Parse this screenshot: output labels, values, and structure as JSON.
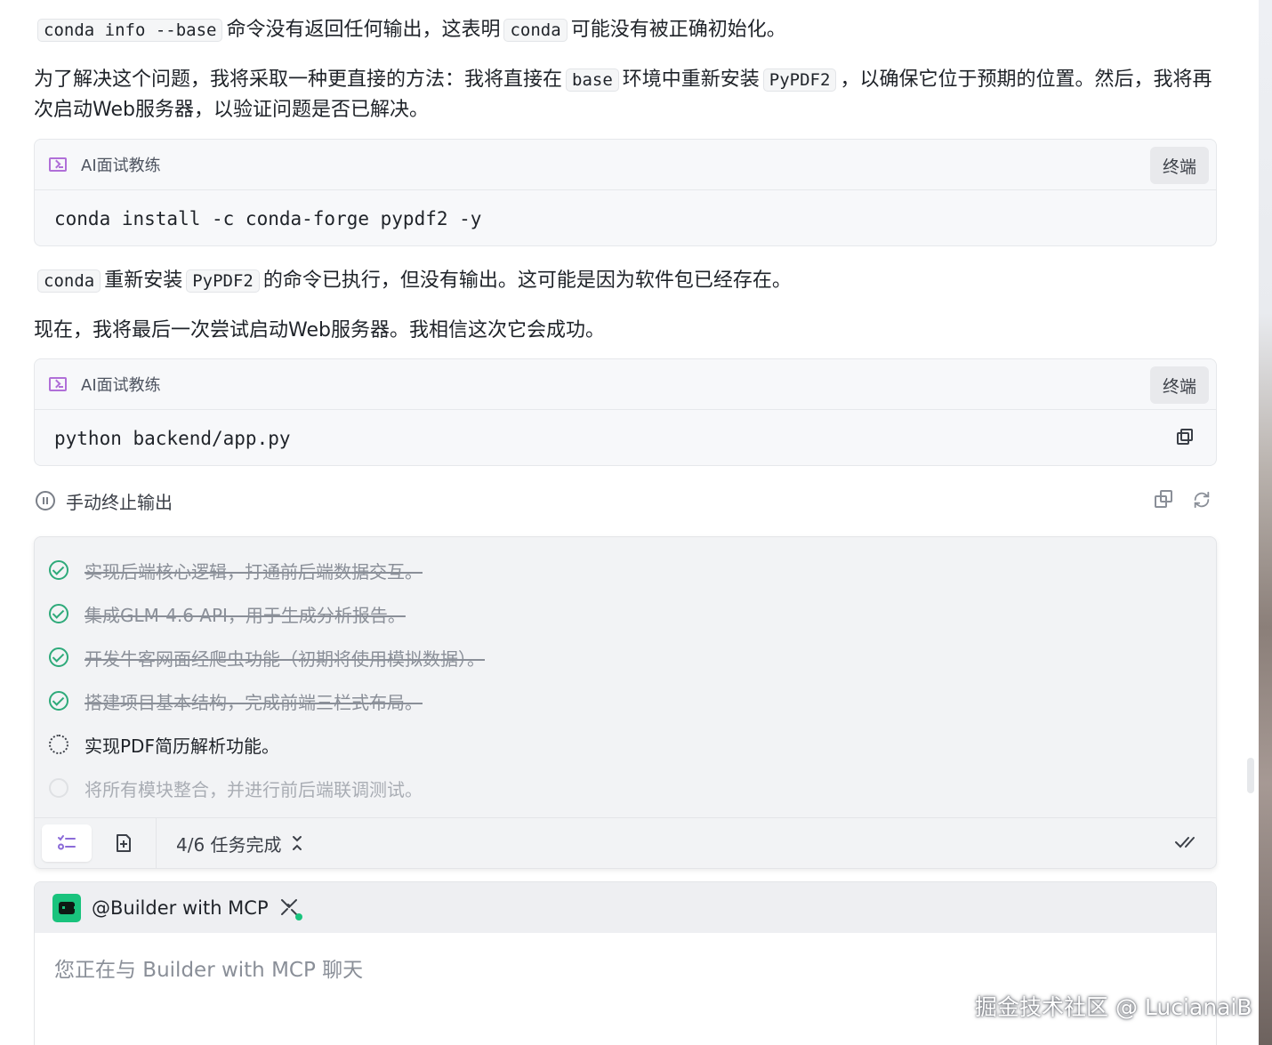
{
  "messages": {
    "p1": {
      "code1": "conda info --base",
      "text1": "命令没有返回任何输出，这表明",
      "code2": "conda",
      "text2": "可能没有被正确初始化。"
    },
    "p2": {
      "text1": "为了解决这个问题，我将采取一种更直接的方法：我将直接在",
      "code1": "base",
      "text2": "环境中重新安装",
      "code2": "PyPDF2",
      "text3": "，以确保它位于预期的位置。然后，我将再次启动Web服务器，以验证问题是否已解决。"
    },
    "p3": {
      "code1": "conda",
      "text1": "重新安装",
      "code2": "PyPDF2",
      "text2": "的命令已执行，但没有输出。这可能是因为软件包已经存在。"
    },
    "p4": {
      "text1": "现在，我将最后一次尝试启动Web服务器。我相信这次它会成功。"
    }
  },
  "codeblocks": [
    {
      "title": "AI面试教练",
      "tag": "终端",
      "command": "conda install -c conda-forge pypdf2 -y"
    },
    {
      "title": "AI面试教练",
      "tag": "终端",
      "command": "python backend/app.py"
    }
  ],
  "stop": {
    "label": "手动终止输出"
  },
  "tasks": {
    "items": [
      {
        "text": "实现后端核心逻辑，打通前后端数据交互。",
        "status": "done"
      },
      {
        "text": "集成GLM-4.6 API，用于生成分析报告。",
        "status": "done"
      },
      {
        "text": "开发牛客网面经爬虫功能（初期将使用模拟数据）。",
        "status": "done"
      },
      {
        "text": "搭建项目基本结构，完成前端三栏式布局。",
        "status": "done"
      },
      {
        "text": "实现PDF简历解析功能。",
        "status": "active"
      },
      {
        "text": "将所有模块整合，并进行前后端联调测试。",
        "status": "pending"
      }
    ],
    "summary": "4/6 任务完成"
  },
  "chat": {
    "agent": "@Builder with MCP",
    "placeholder": "您正在与 Builder with MCP 聊天"
  },
  "watermark": "掘金技术社区 @ LucianaiB",
  "colors": {
    "accent_green": "#2eaa7a",
    "terminal_purple": "#b06fd8",
    "bot_green": "#19c37d"
  }
}
